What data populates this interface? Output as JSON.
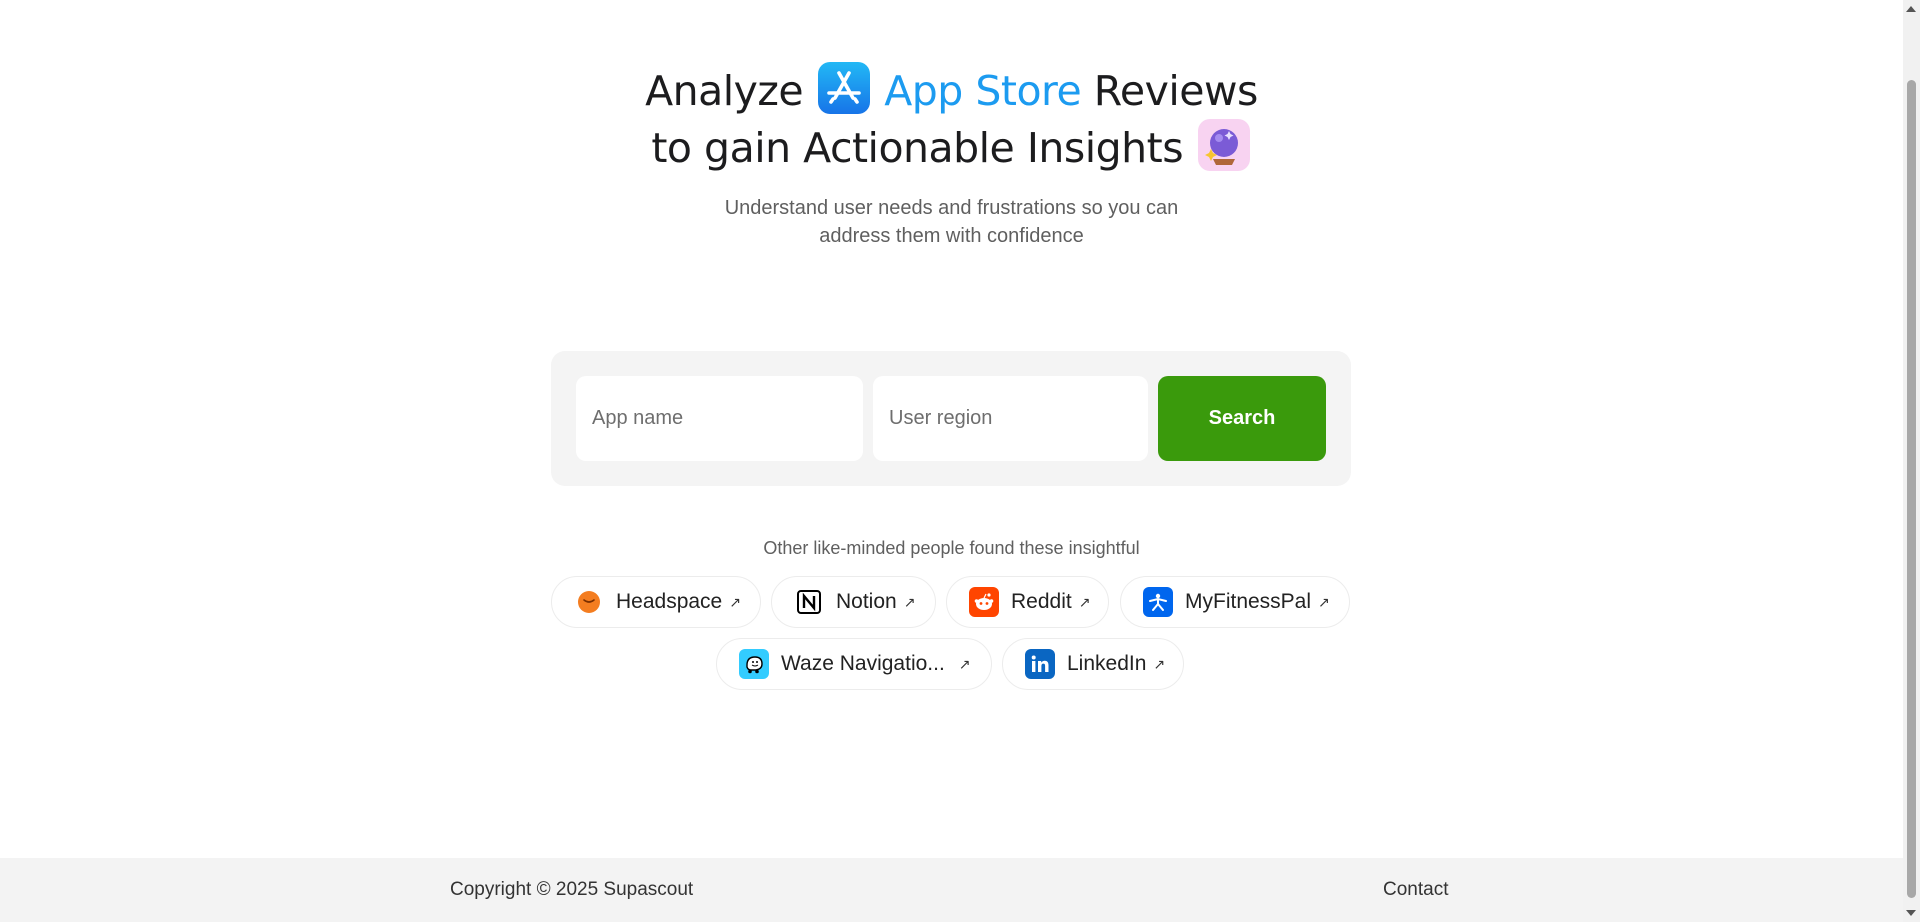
{
  "hero": {
    "title_part1": "Analyze",
    "title_accent": "App Store",
    "title_part2": "Reviews",
    "title_line2": "to gain Actionable Insights",
    "subtitle_line1": "Understand user needs and frustrations so you can",
    "subtitle_line2": "address them with confidence",
    "appstore_icon": "app-store-icon",
    "insight_icon": "crystal-ball-icon"
  },
  "search": {
    "app_placeholder": "App name",
    "region_placeholder": "User region",
    "button_label": "Search",
    "button_color": "#3a9a0c"
  },
  "suggestions": {
    "label": "Other like-minded people found these insightful",
    "items": [
      {
        "name": "Headspace",
        "icon": "headspace-icon",
        "color": "#f47d20"
      },
      {
        "name": "Notion",
        "icon": "notion-icon",
        "color": "#000000"
      },
      {
        "name": "Reddit",
        "icon": "reddit-icon",
        "color": "#ff4500"
      },
      {
        "name": "MyFitnessPal",
        "icon": "myfitnesspal-icon",
        "color": "#0066ee"
      },
      {
        "name": "Waze Navigatio...",
        "icon": "waze-icon",
        "color": "#33ccff"
      },
      {
        "name": "LinkedIn",
        "icon": "linkedin-icon",
        "color": "#0a66c2"
      }
    ],
    "arrow": "↗"
  },
  "footer": {
    "copyright": "Copyright © 2025 Supascout",
    "contact": "Contact"
  },
  "colors": {
    "accent": "#1c9bf0",
    "footer_bg": "#f3f3f3"
  }
}
